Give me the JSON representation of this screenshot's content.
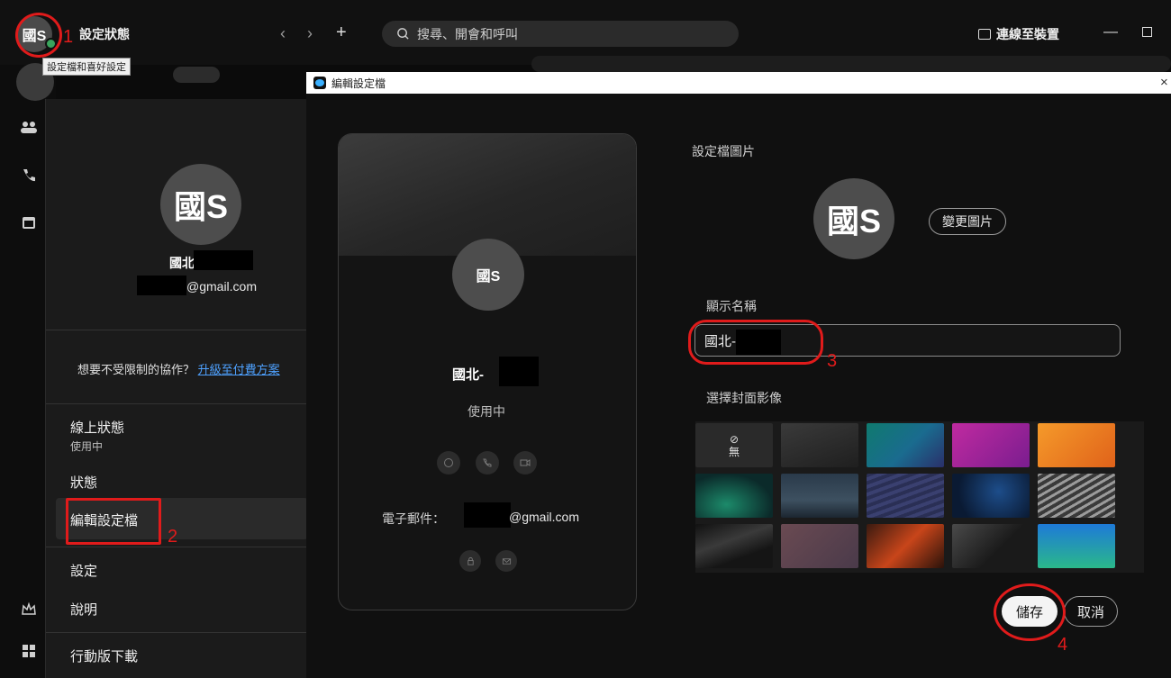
{
  "topbar": {
    "avatar_text": "國S",
    "status_title": "設定狀態",
    "back": "‹",
    "forward": "›",
    "add": "+",
    "search_placeholder": "搜尋、開會和呼叫",
    "connect_label": "連線至裝置",
    "minimize": "—",
    "tooltip": "設定檔和喜好設定"
  },
  "profile_menu": {
    "avatar_text": "國S",
    "name": "國北-",
    "email": "@gmail.com",
    "upgrade_text": "想要不受限制的協作？",
    "upgrade_link": "升級至付費方案",
    "items": [
      {
        "label": "線上狀態",
        "sub": "使用中"
      },
      {
        "label": "狀態"
      },
      {
        "label": "編輯設定檔"
      },
      {
        "label": "設定"
      },
      {
        "label": "說明"
      },
      {
        "label": "行動版下載"
      }
    ]
  },
  "modal": {
    "title": "編輯設定檔",
    "close": "×",
    "preview": {
      "avatar_text": "國S",
      "name": "國北-",
      "status": "使用中",
      "email_label": "電子郵件：",
      "email_value": "@gmail.com"
    },
    "labels": {
      "profile_picture": "設定檔圖片",
      "display_name": "顯示名稱",
      "cover_image": "選擇封面影像"
    },
    "avatar_text": "國S",
    "change_picture": "變更圖片",
    "display_name_value": "國北-",
    "none_tile": {
      "glyph": "⊘",
      "label": "無"
    },
    "save": "儲存",
    "cancel": "取消"
  },
  "annotations": [
    "1",
    "2",
    "3",
    "4"
  ],
  "colors": {
    "annotation": "#e01b1b",
    "link": "#4ea1ff",
    "presence": "#3aa55d"
  }
}
